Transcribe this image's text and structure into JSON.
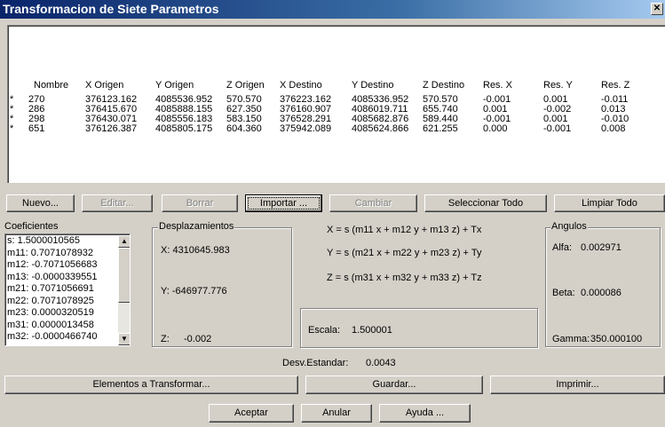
{
  "window": {
    "title": "Transformacion de Siete Parametros",
    "close_glyph": "✕"
  },
  "table": {
    "columns": [
      "Nombre",
      "X Origen",
      "Y Origen",
      "Z Origen",
      "X Destino",
      "Y Destino",
      "Z Destino",
      "Res. X",
      "Res. Y",
      "Res. Z"
    ],
    "rows": [
      {
        "mark": "*",
        "nombre": "270",
        "x_origen": "376123.162",
        "y_origen": "4085536.952",
        "z_origen": "570.570",
        "x_destino": "376223.162",
        "y_destino": "4085336.952",
        "z_destino": "570.570",
        "res_x": "-0.001",
        "res_y": "0.001",
        "res_z": "-0.011"
      },
      {
        "mark": "*",
        "nombre": "286",
        "x_origen": "376415.670",
        "y_origen": "4085888.155",
        "z_origen": "627.350",
        "x_destino": "376160.907",
        "y_destino": "4086019.711",
        "z_destino": "655.740",
        "res_x": "0.001",
        "res_y": "-0.002",
        "res_z": "0.013"
      },
      {
        "mark": "*",
        "nombre": "298",
        "x_origen": "376430.071",
        "y_origen": "4085556.183",
        "z_origen": "583.150",
        "x_destino": "376528.291",
        "y_destino": "4085682.876",
        "z_destino": "589.440",
        "res_x": "-0.001",
        "res_y": "0.001",
        "res_z": "-0.010"
      },
      {
        "mark": "*",
        "nombre": "651",
        "x_origen": "376126.387",
        "y_origen": "4085805.175",
        "z_origen": "604.360",
        "x_destino": "375942.089",
        "y_destino": "4085624.866",
        "z_destino": "621.255",
        "res_x": "0.000",
        "res_y": "-0.001",
        "res_z": "0.008"
      }
    ]
  },
  "buttons": {
    "nuevo": "Nuevo...",
    "editar": "Editar...",
    "borrar": "Borrar",
    "importar": "Importar ...",
    "cambiar": "Cambiar",
    "seleccionar_todo": "Seleccionar Todo",
    "limpiar_todo": "Limpiar Todo",
    "elementos": "Elementos a Transformar...",
    "guardar": "Guardar...",
    "imprimir": "Imprimir...",
    "aceptar": "Aceptar",
    "anular": "Anular",
    "ayuda": "Ayuda ..."
  },
  "coeficientes": {
    "label": "Coeficientes",
    "items": [
      "s: 1.5000010565",
      "m11: 0.7071078932",
      "m12: -0.7071056683",
      "m13: -0.0000339551",
      "m21: 0.7071056691",
      "m22: 0.7071078925",
      "m23: 0.0000320519",
      "m31: 0.0000013458",
      "m32: -0.0000466740"
    ]
  },
  "desplazamientos": {
    "label": "Desplazamientos",
    "x": "X: 4310645.983",
    "y": "Y: -646977.776",
    "z_label": "Z:",
    "z_value": "-0.002"
  },
  "formulas": {
    "x": "X = s (m11 x + m12 y + m13 z) + Tx",
    "y": "Y = s (m21 x + m22 y + m23 z) + Ty",
    "z": "Z = s (m31 x + m32 y + m33 z) + Tz"
  },
  "escala": {
    "label": "Escala:",
    "value": "1.500001"
  },
  "angulos": {
    "label": "Angulos",
    "alfa_label": "Alfa:",
    "alfa_value": "0.002971",
    "beta_label": "Beta:",
    "beta_value": "0.000086",
    "gamma_label": "Gamma:",
    "gamma_value": "350.000100"
  },
  "desv": {
    "label": "Desv.Estandar:",
    "value": "0.0043"
  },
  "scroll": {
    "up_glyph": "▲",
    "down_glyph": "▼"
  }
}
